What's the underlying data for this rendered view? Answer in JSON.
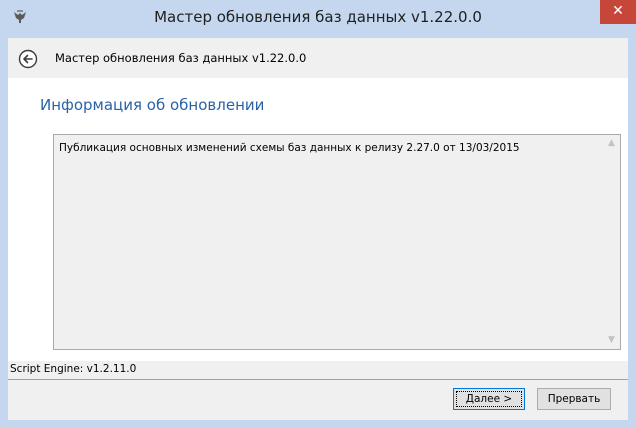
{
  "window": {
    "title": "Мастер обновления баз данных v1.22.0.0",
    "close_glyph": "✕"
  },
  "nav": {
    "title": "Мастер обновления баз данных v1.22.0.0"
  },
  "content": {
    "heading": "Информация об обновлении",
    "update_text": "Публикация основных изменений схемы баз данных к релизу 2.27.0 от 13/03/2015"
  },
  "footer": {
    "engine_label": "Script Engine: v1.2.11.0",
    "next_accel": "Д",
    "next_rest": "алее >",
    "cancel_label": "Прервать"
  },
  "scroll": {
    "up_glyph": "▲",
    "down_glyph": "▼"
  },
  "colors": {
    "frame": "#c4d7ee",
    "close": "#c7463a",
    "heading": "#2a62a8",
    "focus": "#0078d7"
  }
}
